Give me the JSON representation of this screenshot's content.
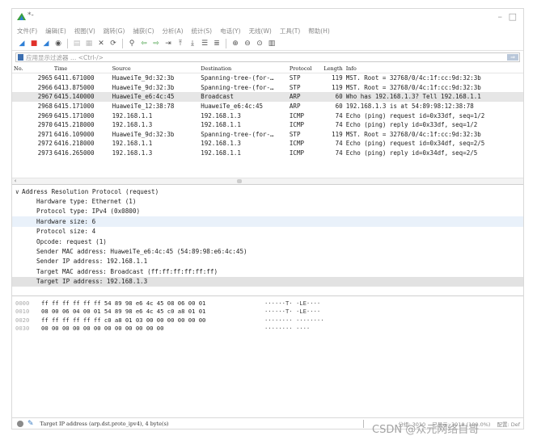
{
  "window": {
    "title": "*-",
    "minimize_glyph": "–",
    "maximize_glyph": "□"
  },
  "menu": [
    "文件(F)",
    "编辑(E)",
    "视图(V)",
    "跳转(G)",
    "捕获(C)",
    "分析(A)",
    "统计(S)",
    "电话(Y)",
    "无线(W)",
    "工具(T)",
    "帮助(H)"
  ],
  "toolbar_icons": [
    "shark-fin-icon",
    "stop-icon",
    "restart-icon",
    "options-icon",
    "open-icon",
    "save-icon",
    "close-file-icon",
    "reload-icon",
    "find-icon",
    "back-icon",
    "forward-icon",
    "goto-icon",
    "first-icon",
    "last-icon",
    "autoscroll-icon",
    "colorize-icon",
    "zoom-in-icon",
    "zoom-out-icon",
    "zoom-normal-icon",
    "resize-columns-icon"
  ],
  "filter": {
    "placeholder": "应用显示过滤器 … <Ctrl-/>"
  },
  "packet_list": {
    "columns": {
      "no": "No.",
      "time": "Time",
      "source": "Source",
      "destination": "Destination",
      "protocol": "Protocol",
      "length": "Length",
      "info": "Info"
    },
    "rows": [
      {
        "no": "2965",
        "time": "6411.671000",
        "src": "HuaweiTe_9d:32:3b",
        "dst": "Spanning-tree-(for-…",
        "proto": "STP",
        "len": "119",
        "info": "MST. Root = 32768/0/4c:1f:cc:9d:32:3b"
      },
      {
        "no": "2966",
        "time": "6413.875000",
        "src": "HuaweiTe_9d:32:3b",
        "dst": "Spanning-tree-(for-…",
        "proto": "STP",
        "len": "119",
        "info": "MST. Root = 32768/0/4c:1f:cc:9d:32:3b"
      },
      {
        "no": "2967",
        "time": "6415.140000",
        "src": "HuaweiTe_e6:4c:45",
        "dst": "Broadcast",
        "proto": "ARP",
        "len": "60",
        "info": "Who has 192.168.1.3? Tell 192.168.1.1"
      },
      {
        "no": "2968",
        "time": "6415.171000",
        "src": "HuaweiTe_12:38:78",
        "dst": "HuaweiTe_e6:4c:45",
        "proto": "ARP",
        "len": "60",
        "info": "192.168.1.3 is at 54:89:98:12:38:78"
      },
      {
        "no": "2969",
        "time": "6415.171000",
        "src": "192.168.1.1",
        "dst": "192.168.1.3",
        "proto": "ICMP",
        "len": "74",
        "info": "Echo (ping) request  id=0x33df, seq=1/2"
      },
      {
        "no": "2970",
        "time": "6415.218000",
        "src": "192.168.1.3",
        "dst": "192.168.1.1",
        "proto": "ICMP",
        "len": "74",
        "info": "Echo (ping) reply    id=0x33df, seq=1/2"
      },
      {
        "no": "2971",
        "time": "6416.109000",
        "src": "HuaweiTe_9d:32:3b",
        "dst": "Spanning-tree-(for-…",
        "proto": "STP",
        "len": "119",
        "info": "MST. Root = 32768/0/4c:1f:cc:9d:32:3b"
      },
      {
        "no": "2972",
        "time": "6416.218000",
        "src": "192.168.1.1",
        "dst": "192.168.1.3",
        "proto": "ICMP",
        "len": "74",
        "info": "Echo (ping) request  id=0x34df, seq=2/5"
      },
      {
        "no": "2973",
        "time": "6416.265000",
        "src": "192.168.1.3",
        "dst": "192.168.1.1",
        "proto": "ICMP",
        "len": "74",
        "info": "Echo (ping) reply    id=0x34df, seq=2/5"
      }
    ],
    "selected_no": "2967"
  },
  "details": {
    "header": "Address Resolution Protocol (request)",
    "fields": [
      "Hardware type: Ethernet (1)",
      "Protocol type: IPv4 (0x0800)",
      "Hardware size: 6",
      "Protocol size: 4",
      "Opcode: request (1)",
      "Sender MAC address: HuaweiTe_e6:4c:45 (54:89:98:e6:4c:45)",
      "Sender IP address: 192.168.1.1",
      "Target MAC address: Broadcast (ff:ff:ff:ff:ff:ff)",
      "Target IP address: 192.168.1.3"
    ],
    "highlighted_field": "Hardware size: 6",
    "selected_field": "Target IP address: 192.168.1.3"
  },
  "bytes": [
    {
      "offset": "0000",
      "hex": "ff ff ff ff ff ff 54 89  98 e6 4c 45 08 06 00 01",
      "ascii": "······T· ·LE····"
    },
    {
      "offset": "0010",
      "hex": "08 00 06 04 00 01 54 89  98 e6 4c 45 c0 a8 01 01",
      "ascii": "······T· ·LE····"
    },
    {
      "offset": "0020",
      "hex": "ff ff ff ff ff ff c0 a8  01 03 00 00 00 00 00 00",
      "ascii": "········ ········"
    },
    {
      "offset": "0030",
      "hex": "00 00 00 00 00 00 00 00  00 00 00 00",
      "ascii": "········ ····"
    }
  ],
  "statusbar": {
    "text": "Target IP address (arp.dst.proto_ipv4), 4 byte(s)",
    "packets": "分组: 3010",
    "displayed": "已显示: 3010 (100.0%)",
    "profile": "配置: Def"
  },
  "watermark": "CSDN @众元网络自哥",
  "colors": {
    "selected_row": "#e6e6e6",
    "highlight_field": "#e9f1fa",
    "brand_blue": "#2e7fd6"
  }
}
